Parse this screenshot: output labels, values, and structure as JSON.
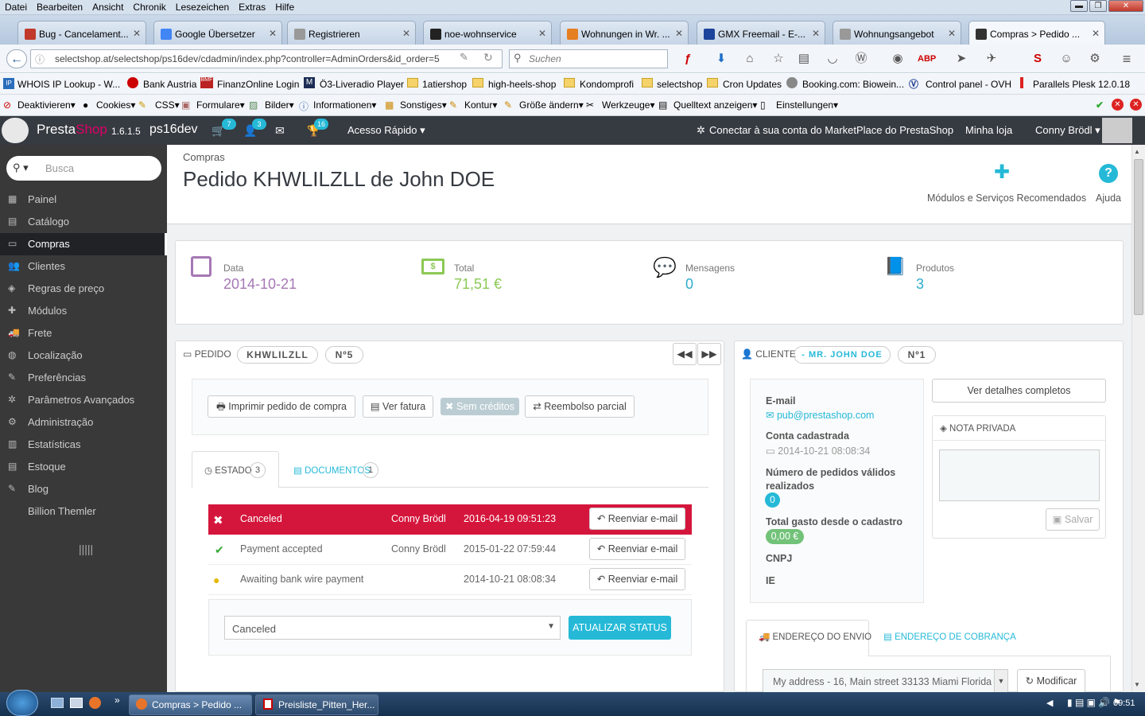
{
  "browser": {
    "menu": [
      "Datei",
      "Bearbeiten",
      "Ansicht",
      "Chronik",
      "Lesezeichen",
      "Extras",
      "Hilfe"
    ],
    "tabs": [
      {
        "label": "Bug - Cancelament...",
        "color": "#c0392b",
        "icon": "bug-icon"
      },
      {
        "label": "Google Übersetzer",
        "color": "#4285f4",
        "icon": "translate-icon"
      },
      {
        "label": "Registrieren",
        "color": "#999999",
        "icon": "page-icon"
      },
      {
        "label": "noe-wohnservice",
        "color": "#222222",
        "icon": "n-icon"
      },
      {
        "label": "Wohnungen in Wr. ...",
        "color": "#e67e22",
        "icon": "house-icon"
      },
      {
        "label": "GMX Freemail - E-...",
        "color": "#1c449b",
        "icon": "gmx-icon"
      },
      {
        "label": "Wohnungsangebot",
        "color": "#999999",
        "icon": "page-icon"
      },
      {
        "label": "Compras > Pedido ...",
        "color": "#333333",
        "icon": "prestashop-icon"
      }
    ],
    "url": "selectshop.at/selectshop/ps16dev/cdadmin/index.php?controller=AdminOrders&id_order=5",
    "search_placeholder": "Suchen",
    "bookmarks": [
      "WHOIS IP Lookup - W...",
      "Bank Austria",
      "FinanzOnline Login",
      "Ö3-Liveradio Player",
      "1atiershop",
      "high-heels-shop",
      "Kondomprofi",
      "selectshop",
      "Cron Updates",
      "Booking.com: Biowein...",
      "Control panel - OVH",
      "Parallels Plesk 12.0.18"
    ],
    "devtools": [
      "Deaktivieren▾",
      "Cookies▾",
      "CSS▾",
      "Formulare▾",
      "Bilder▾",
      "Informationen▾",
      "Sonstiges▾",
      "Kontur▾",
      "Größe ändern▾",
      "Werkzeuge▾",
      "Quelltext anzeigen▾",
      "Einstellungen▾"
    ]
  },
  "header": {
    "logo": "PrestaShop",
    "version": "1.6.1.5",
    "shop": "ps16dev",
    "badges": {
      "orders": "7",
      "customers": "3",
      "messages": "16"
    },
    "quick_access": "Acesso Rápido",
    "marketplace": "Conectar à sua conta do MarketPlace do PrestaShop",
    "my_shop": "Minha loja",
    "user": "Conny Brödl"
  },
  "sidebar": {
    "search_placeholder": "Busca",
    "items": [
      "Painel",
      "Catálogo",
      "Compras",
      "Clientes",
      "Regras de preço",
      "Módulos",
      "Frete",
      "Localização",
      "Preferências",
      "Parâmetros Avançados",
      "Administração",
      "Estatísticas",
      "Estoque",
      "Blog",
      "Billion Themler"
    ]
  },
  "page": {
    "breadcrumb": "Compras",
    "title": "Pedido KHWLILZLL de John DOE",
    "recommended": "Módulos e Serviços Recomendados",
    "help": "Ajuda"
  },
  "kpis": [
    {
      "label": "Data",
      "value": "2014-10-21",
      "color": "#a678b5"
    },
    {
      "label": "Total",
      "value": "71,51 €",
      "color": "#8bc954"
    },
    {
      "label": "Mensagens",
      "value": "0",
      "color": "#2eacce"
    },
    {
      "label": "Produtos",
      "value": "3",
      "color": "#2eacce"
    }
  ],
  "order": {
    "section": "PEDIDO",
    "reference": "KHWLILZLL",
    "number": "Nº5",
    "buttons": [
      "Imprimir pedido de compra",
      "Ver fatura",
      "Sem créditos",
      "Reembolso parcial"
    ],
    "tab_status": "ESTADO",
    "status_count": "3",
    "tab_documents": "DOCUMENTOS",
    "documents_count": "1",
    "history": [
      {
        "status": "Canceled",
        "employee": "Conny Brödl",
        "date": "2016-04-19 09:51:23",
        "action": "Reenviar e-mail"
      },
      {
        "status": "Payment accepted",
        "employee": "Conny Brödl",
        "date": "2015-01-22 07:59:44",
        "action": "Reenviar e-mail"
      },
      {
        "status": "Awaiting bank wire payment",
        "employee": "",
        "date": "2014-10-21 08:08:34",
        "action": "Reenviar e-mail"
      }
    ],
    "status_select": "Canceled",
    "update_button": "ATUALIZAR STATUS"
  },
  "customer": {
    "section": "CLIENTE",
    "name": "- MR. JOHN DOE",
    "number": "Nº1",
    "email_label": "E-mail",
    "email": "pub@prestashop.com",
    "registered_label": "Conta cadastrada",
    "registered": "2014-10-21 08:08:34",
    "orders_label": "Número de pedidos válidos realizados",
    "orders": "0",
    "spent_label": "Total gasto desde o cadastro",
    "spent": "0,00 €",
    "cnpj_label": "CNPJ",
    "ie_label": "IE",
    "details_button": "Ver detalhes completos",
    "note_title": "NOTA PRIVADA",
    "save_button": "Salvar",
    "shipping_tab": "ENDEREÇO DO ENVIO",
    "billing_tab": "ENDEREÇO DE COBRANÇA",
    "address": "My address - 16, Main street 33133 Miami Florida",
    "modify_button": "Modificar"
  },
  "taskbar": {
    "items": [
      "Compras > Pedido ...",
      "Preisliste_Pitten_Her..."
    ],
    "time": "09:51"
  }
}
